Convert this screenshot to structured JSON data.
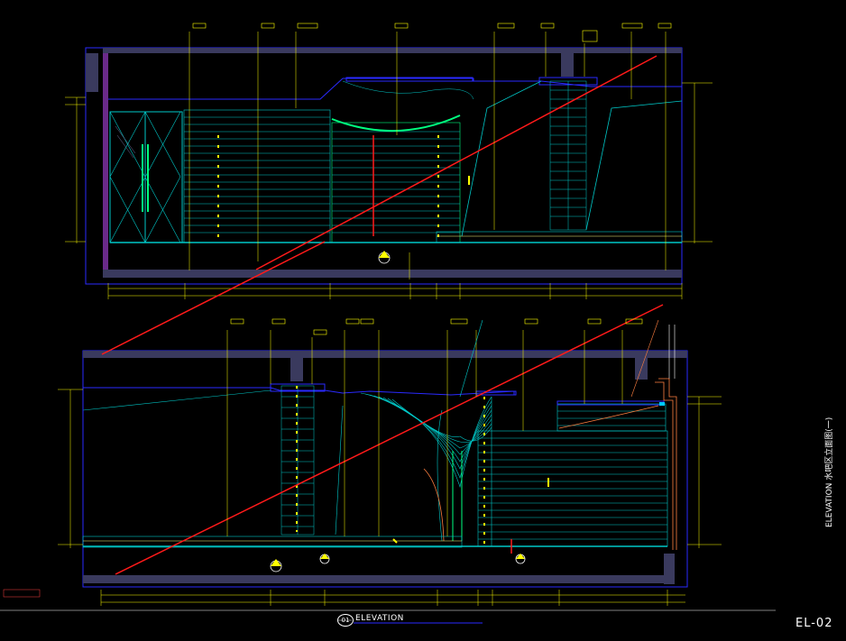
{
  "drawing": {
    "view_title": "ELEVATION",
    "view_number": "01",
    "sheet_number": "EL-02",
    "side_title": "ELEVATION 水吧区立面图(一)"
  },
  "colors": {
    "background": "#000000",
    "frame": "#2a2aff",
    "slab": "#3a3a5e",
    "wall": "#1e1e4a",
    "stripe": "#00c8c8",
    "green": "#00ff80",
    "yellow": "#ffff00",
    "red": "#ff1a1a",
    "white": "#ffffff",
    "magenta": "#c040ff",
    "orange": "#ff8040"
  },
  "icons": {
    "section_marker": "section-marker-icon",
    "level_marker": "level-marker-icon"
  }
}
